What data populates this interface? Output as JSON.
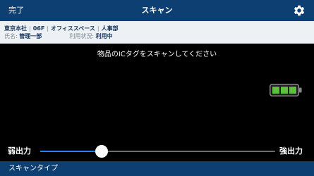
{
  "navbar": {
    "done_label": "完了",
    "title": "スキャン",
    "settings_icon": "gear-icon"
  },
  "info": {
    "location_parts": [
      "東京本社",
      "06F",
      "オフィススペース",
      "人事部"
    ],
    "name_label": "氏名:",
    "name_value": "管理一部",
    "status_label": "利用状況:",
    "status_value": "利用中"
  },
  "prompt": "物品のICタグをスキャンしてください",
  "battery": {
    "icon": "battery-icon",
    "level": 1.0,
    "color": "#5cc13c"
  },
  "power": {
    "weak_label": "弱出力",
    "strong_label": "強出力",
    "level": 0.26
  },
  "bottom": {
    "scan_type_label": "スキャンタイプ"
  },
  "colors": {
    "accent": "#0d3f73",
    "slider_fill": "#2f7ef5"
  }
}
